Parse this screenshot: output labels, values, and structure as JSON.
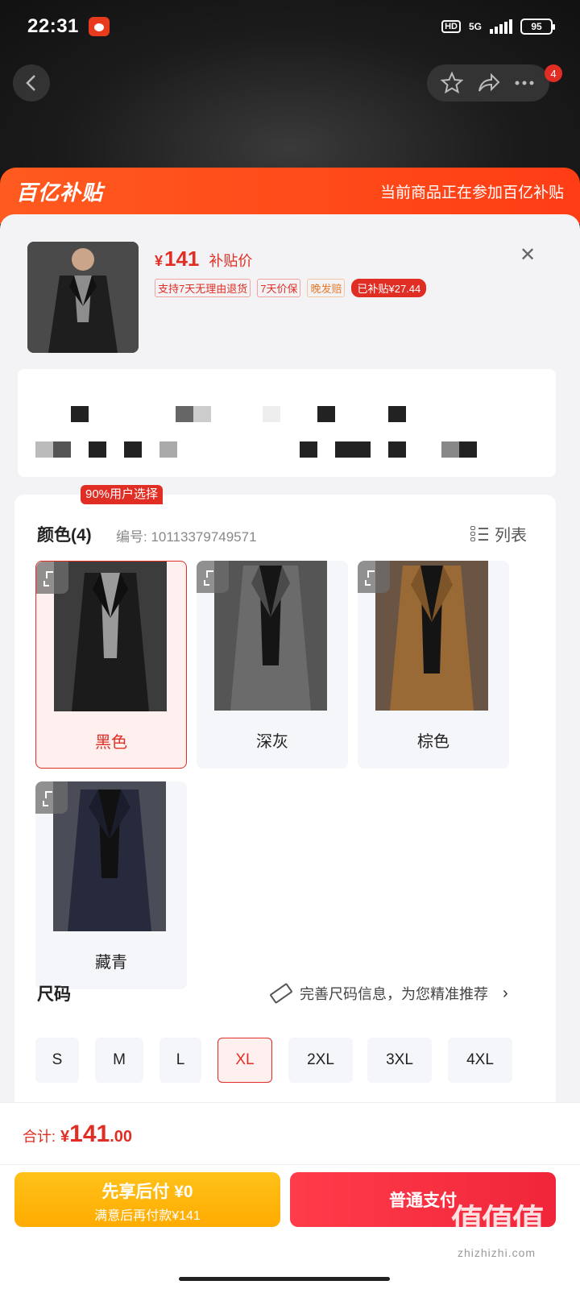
{
  "status_bar": {
    "time": "22:31",
    "hd": "HD",
    "network": "5G",
    "battery": "95"
  },
  "nav": {
    "badge_count": "4"
  },
  "banner": {
    "logo": "百亿补贴",
    "text": "当前商品正在参加百亿补贴"
  },
  "product": {
    "currency": "¥",
    "price": "141",
    "price_label": "补贴价",
    "tags": [
      "支持7天无理由退货",
      "7天价保",
      "晚发赔",
      "已补贴¥27.44"
    ]
  },
  "color_section": {
    "title": "颜色(4)",
    "code": "编号: 10113379749571",
    "view_toggle": "列表",
    "popular_badge": "90%用户选择",
    "options": [
      "黑色",
      "深灰",
      "棕色",
      "藏青"
    ],
    "selected": "黑色"
  },
  "size_section": {
    "title": "尺码",
    "hint": "完善尺码信息，为您精准推荐",
    "options": [
      "S",
      "M",
      "L",
      "XL",
      "2XL",
      "3XL",
      "4XL"
    ],
    "selected": "XL"
  },
  "footer": {
    "total_label": "合计:",
    "total_currency": "¥",
    "total_int": "141",
    "total_dec": ".00",
    "pay_later_title": "先享后付 ¥0",
    "pay_later_sub": "满意后再付款¥141",
    "pay_button": "普通支付",
    "watermark": "值值值",
    "watermark_url": "zhizhizhi.com"
  },
  "colors": {
    "accent": "#e02e24",
    "banner": "#ff4a1a",
    "pay_later": "#ffb300"
  }
}
